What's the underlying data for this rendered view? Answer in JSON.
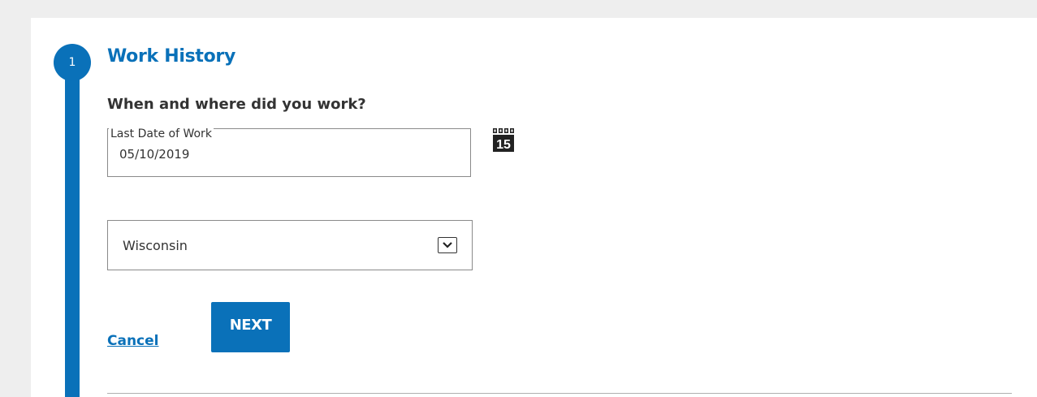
{
  "step": {
    "number": "1",
    "title": "Work History"
  },
  "form": {
    "question": "When and where did you work?",
    "last_date_label": "Last Date of Work",
    "last_date_value": "05/10/2019",
    "calendar_day": "15",
    "state_value": "Wisconsin"
  },
  "actions": {
    "cancel_label": "Cancel",
    "next_label": "NEXT"
  },
  "colors": {
    "accent": "#0a71b9",
    "text": "#333333",
    "background": "#eeeeee"
  },
  "icons": {
    "calendar": "calendar-icon",
    "dropdown": "chevron-down-icon"
  }
}
